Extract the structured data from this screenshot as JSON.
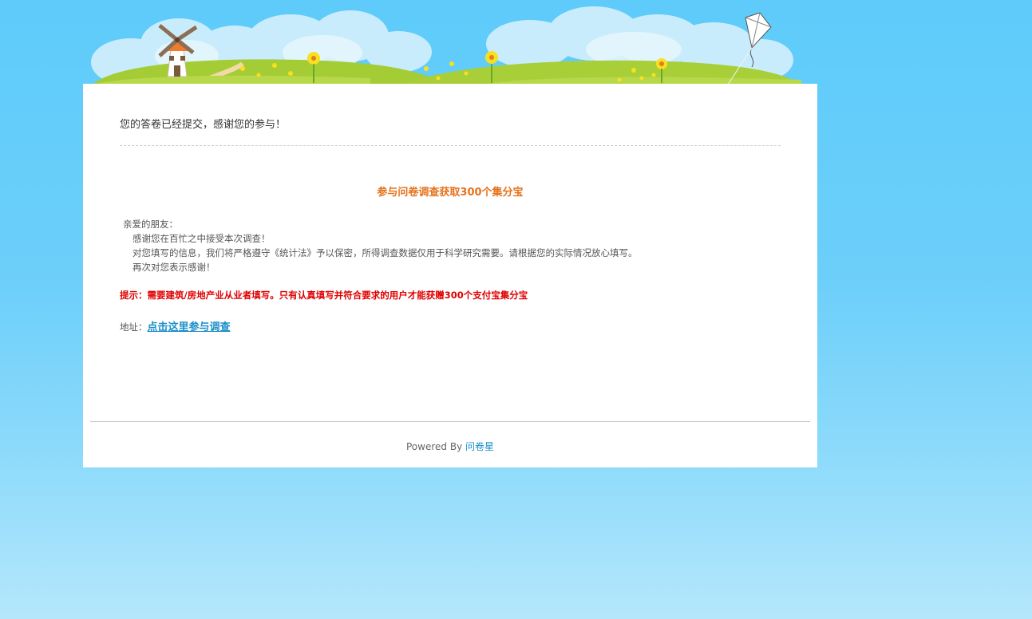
{
  "banner": {
    "sky_color": "#5ecbfa",
    "cloud_color": "#c8ecfc",
    "grass_color": "#a9cf36",
    "flower_color": "#f8e021",
    "windmill_roof_color": "#f07a2e",
    "icons": [
      "windmill-icon",
      "kite-icon",
      "flower-icon",
      "cloud-icon",
      "hill-icon"
    ]
  },
  "card": {
    "submitted_message": "您的答卷已经提交，感谢您的参与！",
    "survey_title": "参与问卷调查获取300个集分宝",
    "letter": {
      "greeting": "亲爱的朋友：",
      "lines": [
        "感谢您在百忙之中接受本次调查！",
        "对您填写的信息，我们将严格遵守《统计法》予以保密，所得调查数据仅用于科学研究需要。请根据您的实际情况放心填写。",
        "再次对您表示感谢！"
      ]
    },
    "notice": "提示：需要建筑/房地产业从业者填写。只有认真填写并符合要求的用户才能获赠300个支付宝集分宝",
    "address_label": "地址：",
    "address_link": "点击这里参与调查",
    "title_color": "#e5711b",
    "notice_color": "#e00000",
    "link_color": "#1a8fc9"
  },
  "footer": {
    "powered_by": "Powered By ",
    "brand": "问卷星"
  }
}
